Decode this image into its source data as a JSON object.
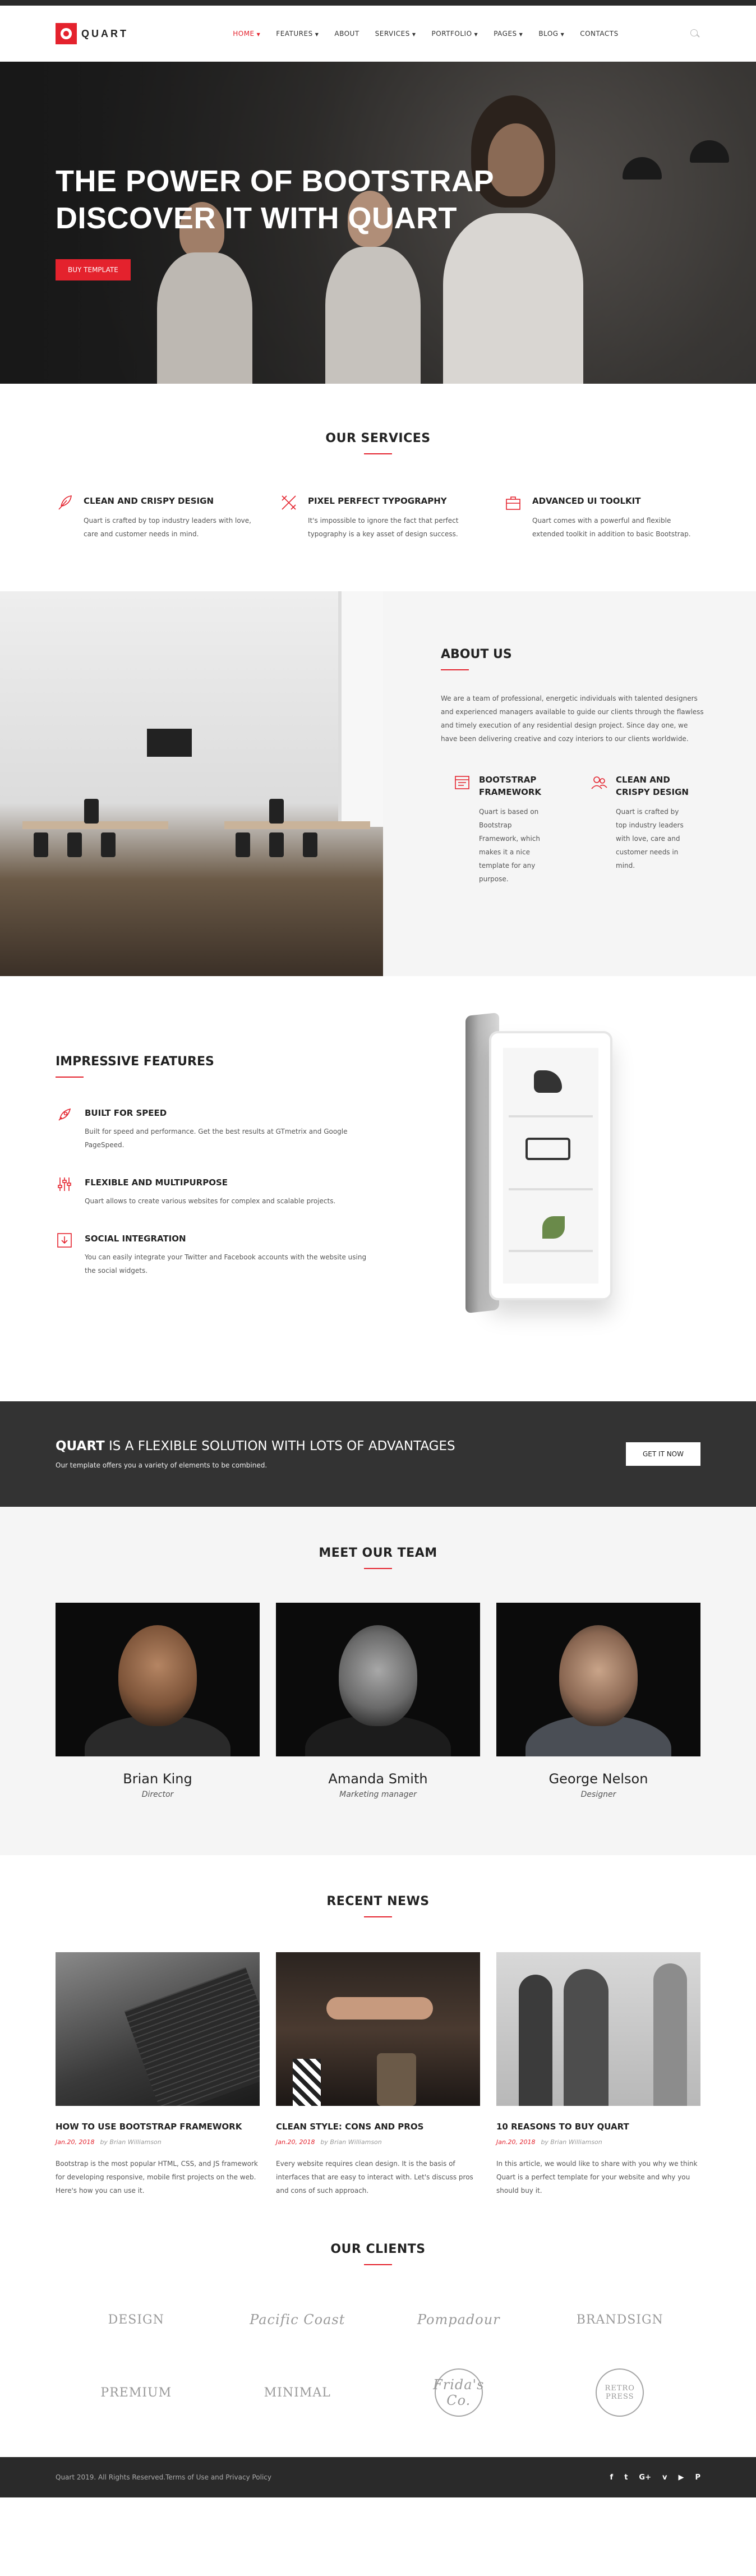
{
  "header": {
    "logo": "QUART",
    "nav": [
      {
        "label": "HOME",
        "caret": "▼"
      },
      {
        "label": "FEATURES",
        "caret": "▼"
      },
      {
        "label": "ABOUT",
        "caret": ""
      },
      {
        "label": "SERVICES",
        "caret": "▼"
      },
      {
        "label": "PORTFOLIO",
        "caret": "▼"
      },
      {
        "label": "PAGES",
        "caret": "▼"
      },
      {
        "label": "BLOG",
        "caret": "▼"
      },
      {
        "label": "CONTACTS",
        "caret": ""
      }
    ]
  },
  "hero": {
    "line1": "THE POWER OF BOOTSTRAP",
    "line2": "DISCOVER IT WITH QUART",
    "button": "BUY TEMPLATE"
  },
  "services": {
    "title": "OUR SERVICES",
    "items": [
      {
        "title": "CLEAN AND CRISPY DESIGN",
        "text": "Quart is crafted by top industry leaders with love, care and customer needs in mind."
      },
      {
        "title": "PIXEL PERFECT TYPOGRAPHY",
        "text": "It's impossible to ignore the fact that perfect typography is a key asset of design success."
      },
      {
        "title": "ADVANCED UI TOOLKIT",
        "text": "Quart comes with a powerful and flexible extended toolkit in addition to basic Bootstrap."
      }
    ]
  },
  "about": {
    "title": "ABOUT US",
    "text": "We are a team of professional, energetic individuals with talented designers and experienced managers available to guide our clients through the flawless and timely execution of any residential design project. Since day one, we have been delivering creative and cozy interiors to our clients worldwide.",
    "features": [
      {
        "title": "BOOTSTRAP FRAMEWORK",
        "text": "Quart is based on Bootstrap Framework, which makes it a nice template for any purpose."
      },
      {
        "title": "CLEAN AND CRISPY DESIGN",
        "text": "Quart is crafted by top industry leaders with love, care and customer needs in mind."
      }
    ]
  },
  "features": {
    "title": "IMPRESSIVE FEATURES",
    "items": [
      {
        "title": "BUILT FOR SPEED",
        "text": "Built for speed and performance. Get the best results at GTmetrix and Google PageSpeed."
      },
      {
        "title": "FLEXIBLE AND MULTIPURPOSE",
        "text": "Quart allows to create various websites for complex and scalable projects."
      },
      {
        "title": "SOCIAL INTEGRATION",
        "text": "You can easily integrate your Twitter and Facebook accounts with the website using the social widgets."
      }
    ]
  },
  "cta": {
    "brand": "QUART",
    "title": " IS A FLEXIBLE SOLUTION WITH LOTS OF ADVANTAGES",
    "subtitle": "Our template offers you a variety of elements to be combined.",
    "button": "GET IT NOW"
  },
  "team": {
    "title": "MEET OUR TEAM",
    "members": [
      {
        "name": "Brian King",
        "role": "Director"
      },
      {
        "name": "Amanda Smith",
        "role": "Marketing manager"
      },
      {
        "name": "George Nelson",
        "role": "Designer"
      }
    ]
  },
  "news": {
    "title": "RECENT NEWS",
    "posts": [
      {
        "title": "HOW TO USE BOOTSTRAP FRAMEWORK",
        "date": "Jan.20, 2018",
        "author": "by Brian Williamson",
        "text": "Bootstrap is the most popular HTML, CSS, and JS framework for developing responsive, mobile first projects on the web. Here's how you can use it."
      },
      {
        "title": "CLEAN STYLE: CONS AND PROS",
        "date": "Jan.20, 2018",
        "author": "by Brian Williamson",
        "text": "Every website requires clean design. It is the basis of interfaces that are easy to interact with. Let's discuss pros and cons of such approach."
      },
      {
        "title": "10 REASONS TO BUY QUART",
        "date": "Jan.20, 2018",
        "author": "by Brian Williamson",
        "text": "In this article, we would like to share with you why we think Quart is a perfect template for your website and why you should buy it."
      }
    ]
  },
  "clients": {
    "title": "OUR CLIENTS",
    "logos": [
      "DESIGN",
      "Pacific Coast",
      "Pompadour",
      "BRANDSIGN",
      "PREMIUM",
      "MINIMAL",
      "Frida's Co.",
      "RETRO PRESS"
    ]
  },
  "footer": {
    "copyright": "Quart 2019. All Rights Reserved.",
    "terms": "Terms of Use and Privacy Policy",
    "socials": [
      "f",
      "t",
      "G+",
      "v",
      "▶",
      "P"
    ]
  },
  "colors": {
    "accent": "#e4222d",
    "dark": "#333333",
    "footer": "#2a2a2a"
  }
}
